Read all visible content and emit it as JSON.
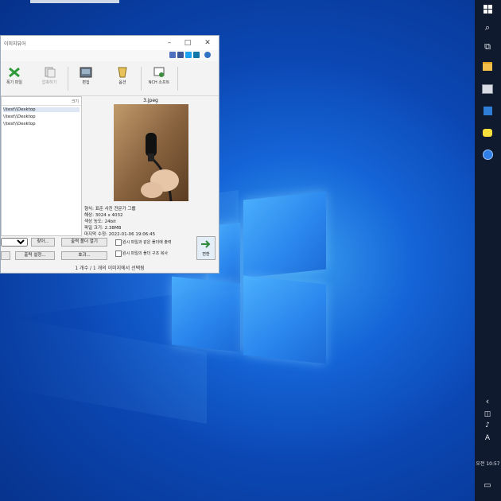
{
  "window": {
    "title": "이미지뷰어",
    "toolbar": [
      "폭기 파일",
      "압축하기",
      "편집",
      "옵션",
      "NCH 소프트"
    ],
    "list_header": "크기",
    "list_items": [
      "\\\\test\\\\Desktop",
      "\\\\test\\\\Desktop",
      "\\\\test\\\\Desktop"
    ],
    "preview_title": "3.jpeg",
    "info_lines": [
      "형식: 표준 사진 전문가 그룹",
      "해상: 3024 x 4032",
      "색상 농도: 24bit",
      "파일 크기: 2.38MB",
      "마지막 수정: 2022-01-06 19:06:45"
    ],
    "buttons": {
      "browse": "찾아...",
      "open_folder": "출력 폴더 열기",
      "output_settings": "출력 설정...",
      "more": "효과...",
      "convert": "변환"
    },
    "checkboxes": [
      "원시 파일과 같은 폴더에 출력",
      "원시 파일의 폴더 구조 복사"
    ],
    "status": "1 개수 / 1 개의 이미지에서 선택됨"
  },
  "taskbar": {
    "clock": "오전 10:57",
    "lang": "A",
    "icons": [
      "windows-icon",
      "search-icon",
      "task-view-icon",
      "file-explorer-icon",
      "app-icon",
      "store-icon",
      "kakaotalk-icon",
      "browser-icon",
      "chevron-up-icon",
      "network-icon",
      "volume-icon",
      "notification-icon"
    ]
  },
  "colors": {
    "taskbar": "#0f1a2e",
    "desktop": "#1565d8",
    "accent": "#2a86ee"
  }
}
